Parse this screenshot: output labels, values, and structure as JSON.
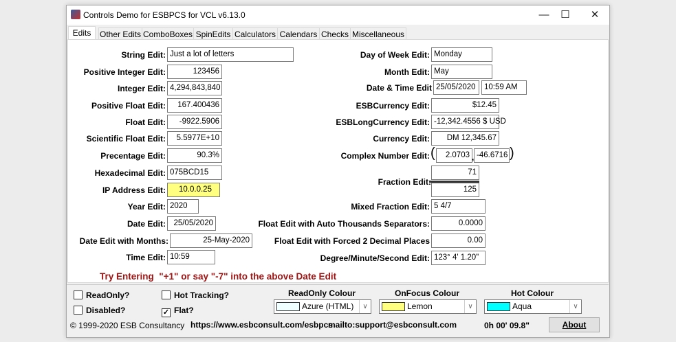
{
  "window": {
    "title": "Controls Demo for ESBPCS for VCL v6.13.0",
    "minimize": "—",
    "maximize": "☐",
    "close": "✕"
  },
  "tabs": [
    "Edits",
    "Other Edits",
    "ComboBoxes",
    "SpinEdits",
    "Calculators",
    "Calendars",
    "Checks",
    "Miscellaneous"
  ],
  "left": [
    {
      "label": "String Edit:",
      "value": "Just a lot of letters"
    },
    {
      "label": "Positive Integer Edit:",
      "value": "123456"
    },
    {
      "label": "Integer Edit:",
      "value": "4,294,843,840"
    },
    {
      "label": "Positive Float Edit:",
      "value": "167.400436"
    },
    {
      "label": "Float Edit:",
      "value": "-9922.5906"
    },
    {
      "label": "Scientific Float Edit:",
      "value": "5.5977E+10"
    },
    {
      "label": "Precentage Edit:",
      "value": "90.3%"
    },
    {
      "label": "Hexadecimal Edit:",
      "value": "075BCD15"
    },
    {
      "label": "IP Address Edit:",
      "value": "10.0.0.25"
    },
    {
      "label": "Year Edit:",
      "value": "2020"
    },
    {
      "label": "Date Edit:",
      "value": "25/05/2020"
    },
    {
      "label": "Date Edit with Months:",
      "value": "25-May-2020"
    },
    {
      "label": "Time Edit:",
      "value": "10:59"
    }
  ],
  "right": {
    "day_of_week": {
      "label": "Day of Week Edit:",
      "value": "Monday"
    },
    "month": {
      "label": "Month Edit:",
      "value": "May"
    },
    "date_time": {
      "label": "Date & Time Edit",
      "date": "25/05/2020",
      "time": "10:59 AM"
    },
    "esbcurrency": {
      "label": "ESBCurrency Edit:",
      "value": "$12.45"
    },
    "esblongcurrency": {
      "label": "ESBLongCurrency Edit:",
      "value": "-12,342.4556 $ USD"
    },
    "currency": {
      "label": "Currency Edit:",
      "value": "DM 12,345.67"
    },
    "complex": {
      "label": "Complex Number Edit:",
      "real": "2.0703",
      "imag": "-46.6716",
      "open": "(",
      "close": ")",
      "sep": ","
    },
    "fraction": {
      "label": "Fraction Edit:",
      "numerator": "71",
      "denominator": "125"
    },
    "mixed_fraction": {
      "label": "Mixed Fraction Edit:",
      "value": "5 4/7"
    },
    "auto_thousands": {
      "label": "Float Edit with Auto Thousands Separators:",
      "value": "0.0000"
    },
    "forced_2dp": {
      "label": "Float Edit with Forced 2 Decimal Places",
      "value": "0.00"
    },
    "dms": {
      "label": "Degree/Minute/Second Edit:",
      "value": "123° 4' 1.20\""
    }
  },
  "hint": "Try Entering  \"+1\" or say \"-7\" into the above Date Edit",
  "options": {
    "readonly": {
      "label": "ReadOnly?",
      "checked": false
    },
    "disabled": {
      "label": "Disabled?",
      "checked": false
    },
    "hot_tracking": {
      "label": "Hot Tracking?",
      "checked": false
    },
    "flat": {
      "label": "Flat?",
      "checked": true
    },
    "check_mark": "✓"
  },
  "colours": [
    {
      "header": "ReadOnly Colour",
      "value": "Azure (HTML)",
      "color": "#F0FFFF"
    },
    {
      "header": "OnFocus Colour",
      "value": "Lemon",
      "color": "#FFFF80"
    },
    {
      "header": "Hot Colour",
      "value": "Aqua",
      "color": "#00FFFF"
    }
  ],
  "footer": {
    "copyright": "© 1999-2020 ESB Consultancy",
    "url": "https://www.esbconsult.com/esbpcs",
    "mail": "mailto:support@esbconsult.com",
    "timer": "0h 00' 09.8\"",
    "about": "About"
  },
  "ip_focus_color": "#FFFF80"
}
